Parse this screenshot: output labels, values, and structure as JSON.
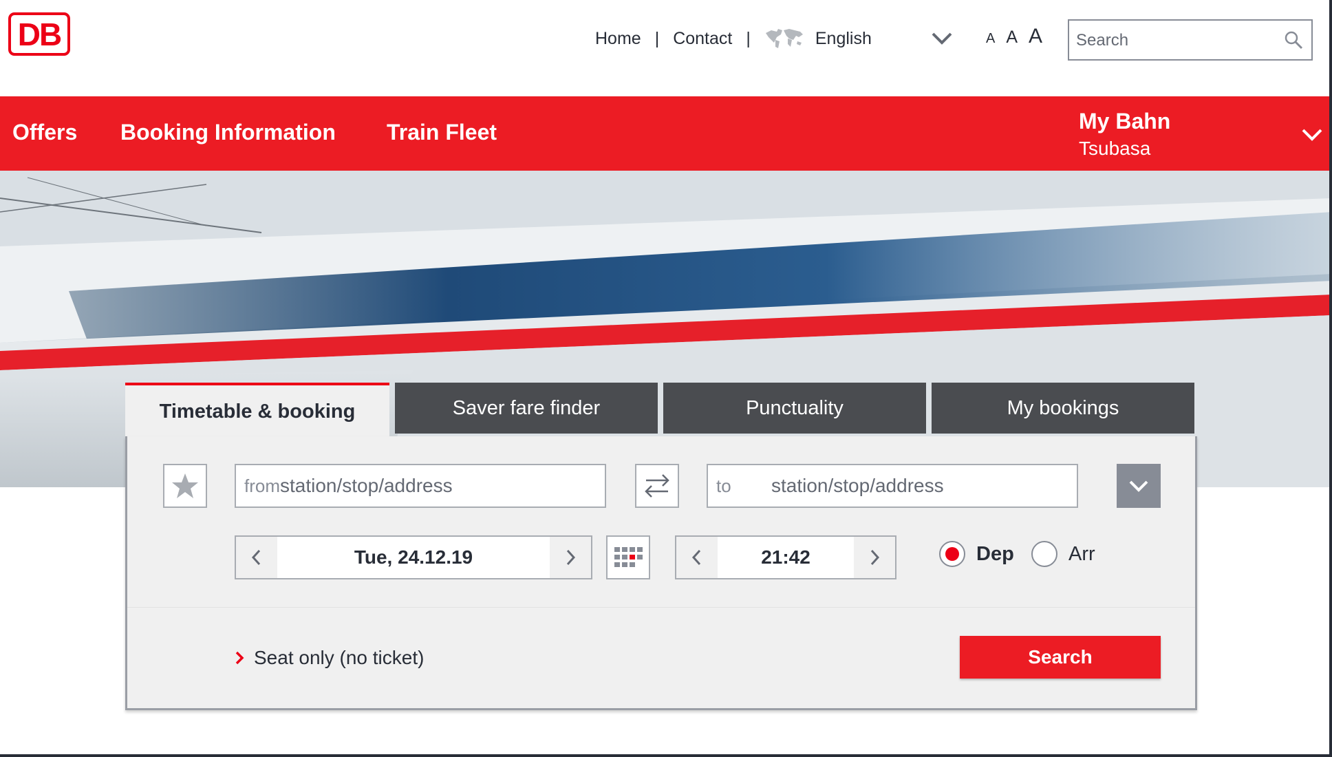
{
  "brand": {
    "logo_text": "DB",
    "accent_color": "#ec0016"
  },
  "header": {
    "links": [
      "Home",
      "Contact"
    ],
    "language": "English",
    "font_size_labels": [
      "A",
      "A",
      "A"
    ],
    "search_placeholder": "Search"
  },
  "nav": {
    "items": [
      "Offers",
      "Booking Information",
      "Train Fleet"
    ],
    "account_title": "My Bahn",
    "account_user": "Tsubasa"
  },
  "booking": {
    "tabs": [
      "Timetable & booking",
      "Saver fare finder",
      "Punctuality",
      "My bookings"
    ],
    "active_tab": "Timetable & booking",
    "from_prefix": "from",
    "from_placeholder": "station/stop/address",
    "to_prefix": "to",
    "to_placeholder": "station/stop/address",
    "date": "Tue, 24.12.19",
    "time": "21:42",
    "departure_label": "Dep",
    "arrival_label": "Arr",
    "selected_mode": "Dep",
    "seat_only_label": "Seat only (no ticket)",
    "search_button": "Search"
  }
}
